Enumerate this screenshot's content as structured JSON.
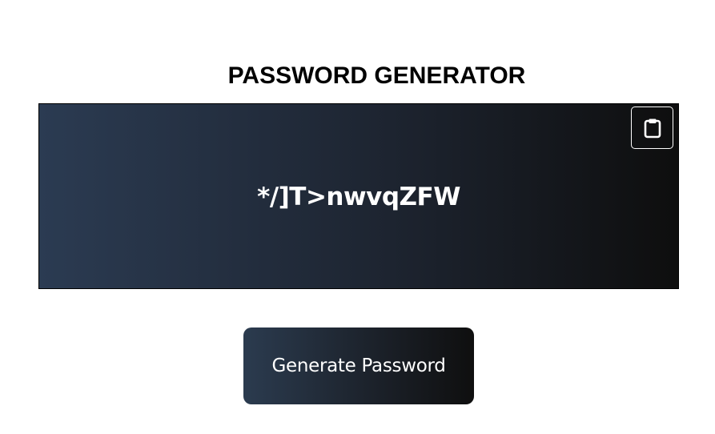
{
  "header": {
    "title": "PASSWORD GENERATOR"
  },
  "display": {
    "password": "*/]T>nwvqZFW",
    "copy_icon": "clipboard-icon"
  },
  "actions": {
    "generate_label": "Generate Password"
  },
  "colors": {
    "gradient_start": "#2b3b52",
    "gradient_end": "#0e0e0e",
    "text": "#ffffff",
    "title": "#000000"
  }
}
